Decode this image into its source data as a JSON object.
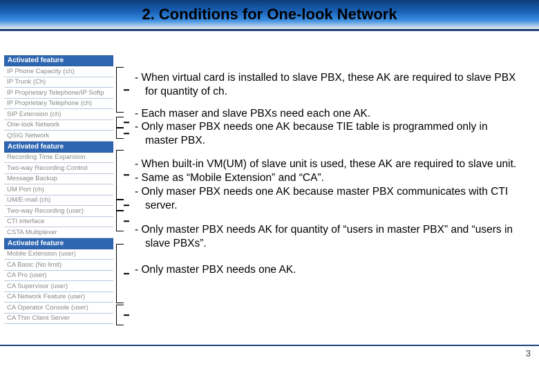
{
  "header": {
    "title": "2. Conditions for One-look Network"
  },
  "left": {
    "sections": [
      {
        "head": "Activated feature",
        "rows": [
          "IP Phone Capacity (ch)",
          "IP Trunk (Ch)",
          "IP Proprietary Telephone/IP Softp",
          "IP Proprietary Telephone (ch)",
          "SIP Extension (ch)",
          "One-look Network",
          "QSIG Network"
        ]
      },
      {
        "head": "Activated feature",
        "rows": [
          "Recording Time Expansion",
          "Two-way Recording Control",
          "Message Backup",
          "UM Port (ch)",
          "UM/E-mail (ch)",
          "Two-way Recording (user)",
          "CTI interface",
          "CSTA Multiplexer"
        ]
      },
      {
        "head": "Activated feature",
        "rows": [
          "Mobile Extension (user)",
          "CA Basic (No limit)",
          "CA Pro (user)",
          "CA Supervisor (user)",
          "CA Network Feature (user)",
          "CA Operator Console (user)",
          "CA Thin Client Server"
        ]
      }
    ]
  },
  "notes": {
    "g1": "- When virtual card is installed to slave PBX, these AK are required to slave PBX for quantity of ch.",
    "g2a": "- Each maser and slave PBXs need each one AK.",
    "g2b": "- Only maser PBX needs one AK because TIE table is programmed only in master PBX.",
    "g3a": "- When built-in VM(UM) of slave unit is used, these AK are required to slave unit.",
    "g3b": "- Same as “Mobile Extension” and “CA”.",
    "g3c": "- Only maser PBX needs one AK because master PBX communicates with CTI server.",
    "g4": "- Only master PBX needs AK for quantity of “users in master PBX” and “users in slave PBXs”.",
    "g5": "- Only master PBX needs one AK."
  },
  "page": "3"
}
